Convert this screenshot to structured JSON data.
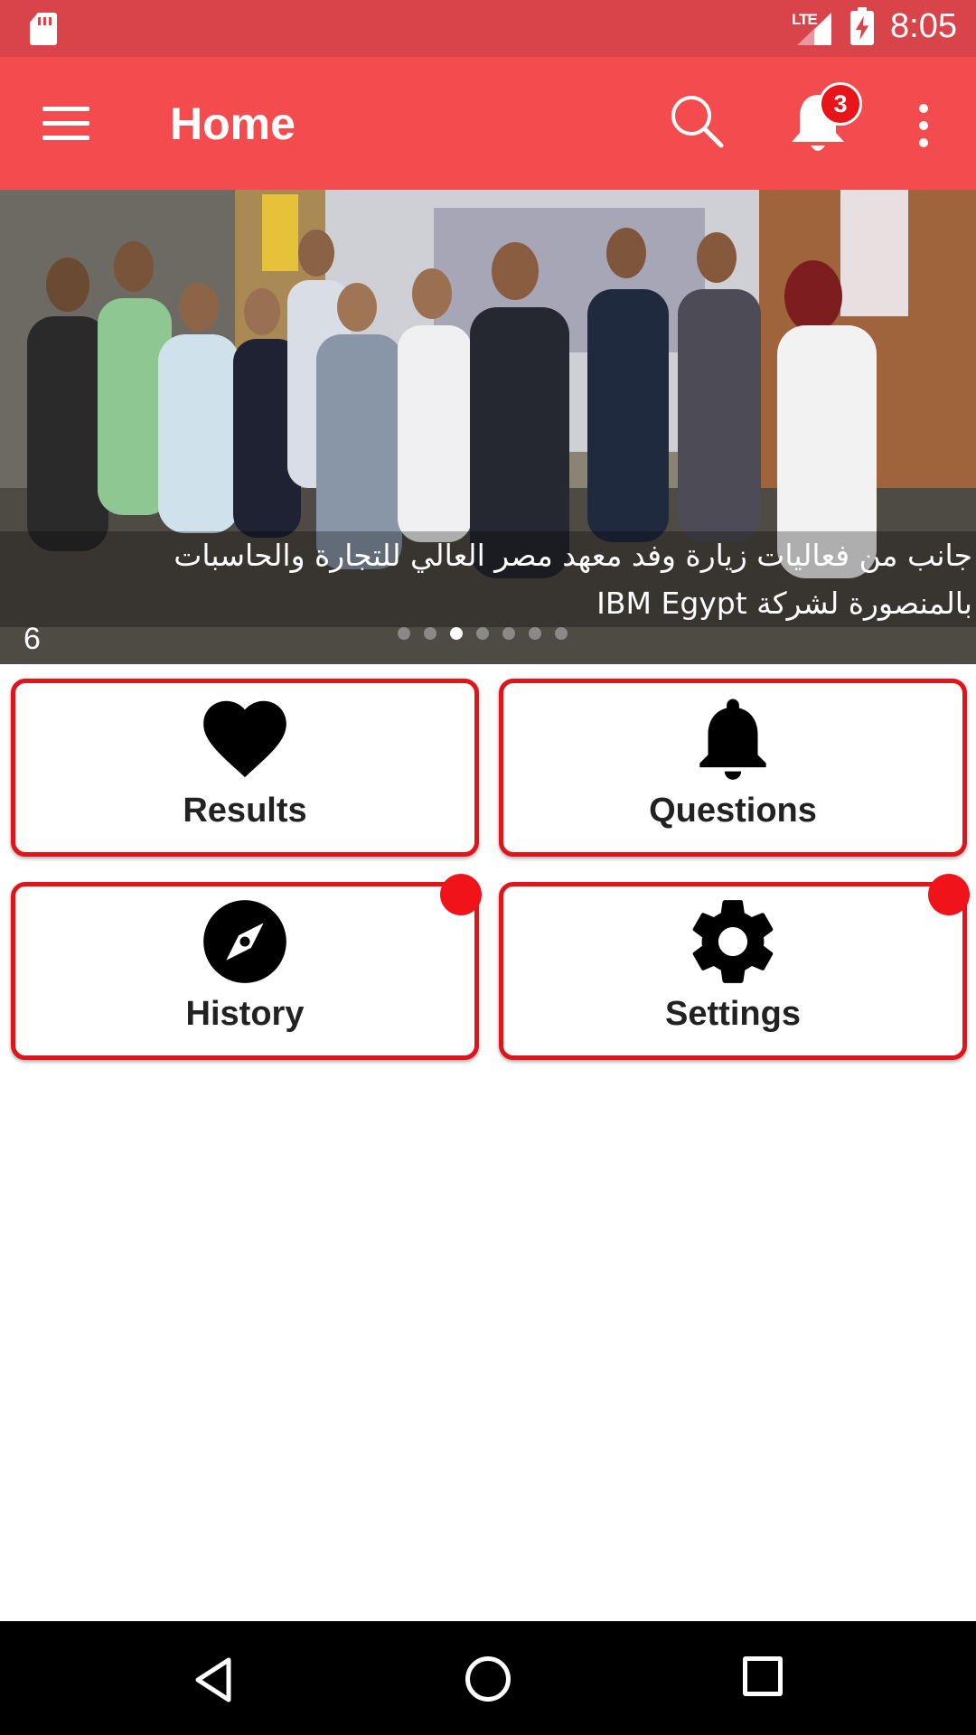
{
  "status_bar": {
    "network": "LTE",
    "time": "8:05"
  },
  "app_bar": {
    "title": "Home",
    "notification_count": "3",
    "icons": [
      "menu-icon",
      "search-icon",
      "bell-icon",
      "overflow-menu-icon"
    ]
  },
  "carousel": {
    "caption": "جانب من فعاليات زيارة وفد معهد مصر العالي للتجارة والحاسبات بالمنصورة لشركة IBM Egypt",
    "slide_number": "6",
    "active_slide_index": 2,
    "slide_count": 7
  },
  "tiles": [
    {
      "label": "Results",
      "icon": "heart-icon",
      "has_dot": false
    },
    {
      "label": "Questions",
      "icon": "bell-icon",
      "has_dot": false
    },
    {
      "label": "History",
      "icon": "compass-icon",
      "has_dot": true
    },
    {
      "label": "Settings",
      "icon": "gear-icon",
      "has_dot": true
    }
  ],
  "colors": {
    "status_bar": "#d9434a",
    "app_bar": "#f44c4e",
    "tile_border": "#e0141a",
    "badge": "#e8141a"
  }
}
